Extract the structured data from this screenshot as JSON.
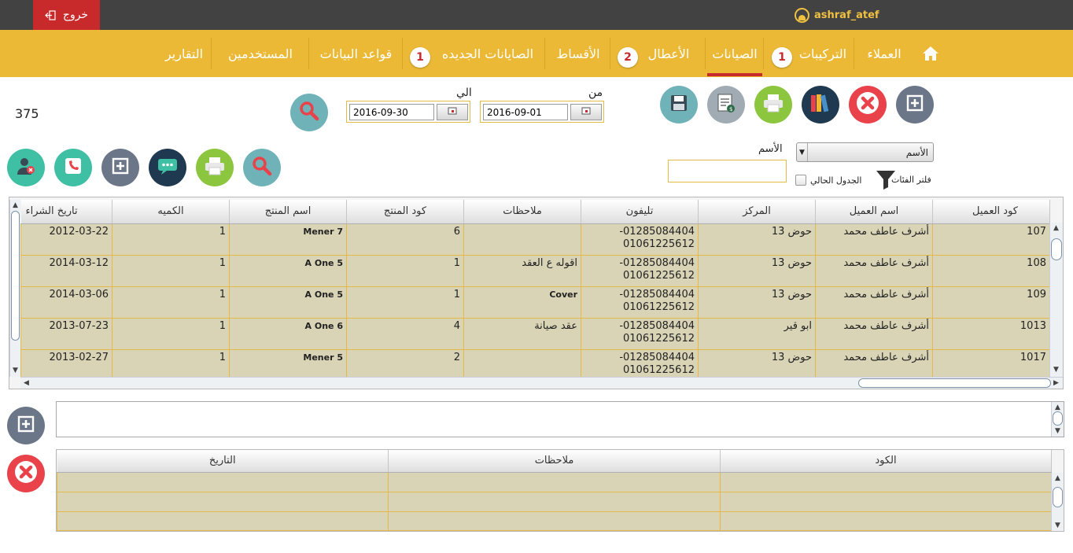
{
  "topbar": {
    "logout_label": "خروج",
    "username": "ashraf_atef"
  },
  "nav": {
    "items": [
      {
        "label": "العملاء"
      },
      {
        "label": "التركيبات",
        "badge": "1"
      },
      {
        "label": "الصيانات"
      },
      {
        "label": "الأعطال",
        "badge": "2"
      },
      {
        "label": "الأقساط"
      },
      {
        "label": "الصايانات الجديده",
        "badge": "1"
      },
      {
        "label": "قواعد البيانات"
      },
      {
        "label": "المستخدمين"
      },
      {
        "label": "التقارير"
      }
    ],
    "active": "الصيانات"
  },
  "toolbar": {
    "icons": [
      "add-icon",
      "delete-icon",
      "archive-icon",
      "print-icon",
      "invoice-icon",
      "save-icon"
    ]
  },
  "date_filter": {
    "from_label": "من",
    "from_value": "2016-09-01",
    "to_label": "الي",
    "to_value": "2016-09-30"
  },
  "record_count": "375",
  "filter": {
    "name_select": "الأسم",
    "name_label": "الأسم",
    "name_input_value": "",
    "current_table_label": "الجدول الحالي",
    "category_filter_label": "فلتر الفئات"
  },
  "main_table": {
    "columns": [
      "كود العميل",
      "اسم العميل",
      "المركز",
      "تليفون",
      "ملاحظات",
      "كود المنتج",
      "اسم المنتج",
      "الكميه",
      "تاريخ الشراء"
    ],
    "rows": [
      [
        "107",
        "أشرف عاطف محمد",
        "حوض 13",
        "01285084404-\n01061225612",
        "",
        "6",
        "Mener 7",
        "1",
        "2012-03-22"
      ],
      [
        "108",
        "أشرف عاطف محمد",
        "حوض 13",
        "01285084404-\n01061225612",
        "اقوله ع العقد",
        "1",
        "A One 5",
        "1",
        "2014-03-12"
      ],
      [
        "109",
        "أشرف عاطف محمد",
        "حوض 13",
        "01285084404-\n01061225612",
        "Cover",
        "1",
        "A One 5",
        "1",
        "2014-03-06"
      ],
      [
        "1013",
        "أشرف عاطف محمد",
        "ابو قير",
        "01285084404-\n01061225612",
        "عقد صيانة",
        "4",
        "A One 6",
        "1",
        "2013-07-23"
      ],
      [
        "1017",
        "أشرف عاطف محمد",
        "حوض 13",
        "01285084404-\n01061225612",
        "",
        "2",
        "Mener 5",
        "1",
        "2013-02-27"
      ]
    ]
  },
  "notes_input": {
    "value": ""
  },
  "notes_table": {
    "columns": [
      "الكود",
      "ملاحظات",
      "التاريخ"
    ],
    "rows": [
      [
        "",
        "",
        ""
      ],
      [
        "",
        "",
        ""
      ],
      [
        "",
        "",
        ""
      ]
    ]
  },
  "colors": {
    "topbar": "#424242",
    "navbar": "#ebb935",
    "logout": "#c8292b",
    "row_bg": "#d9d4b6",
    "row_border": "#e5b84a"
  }
}
